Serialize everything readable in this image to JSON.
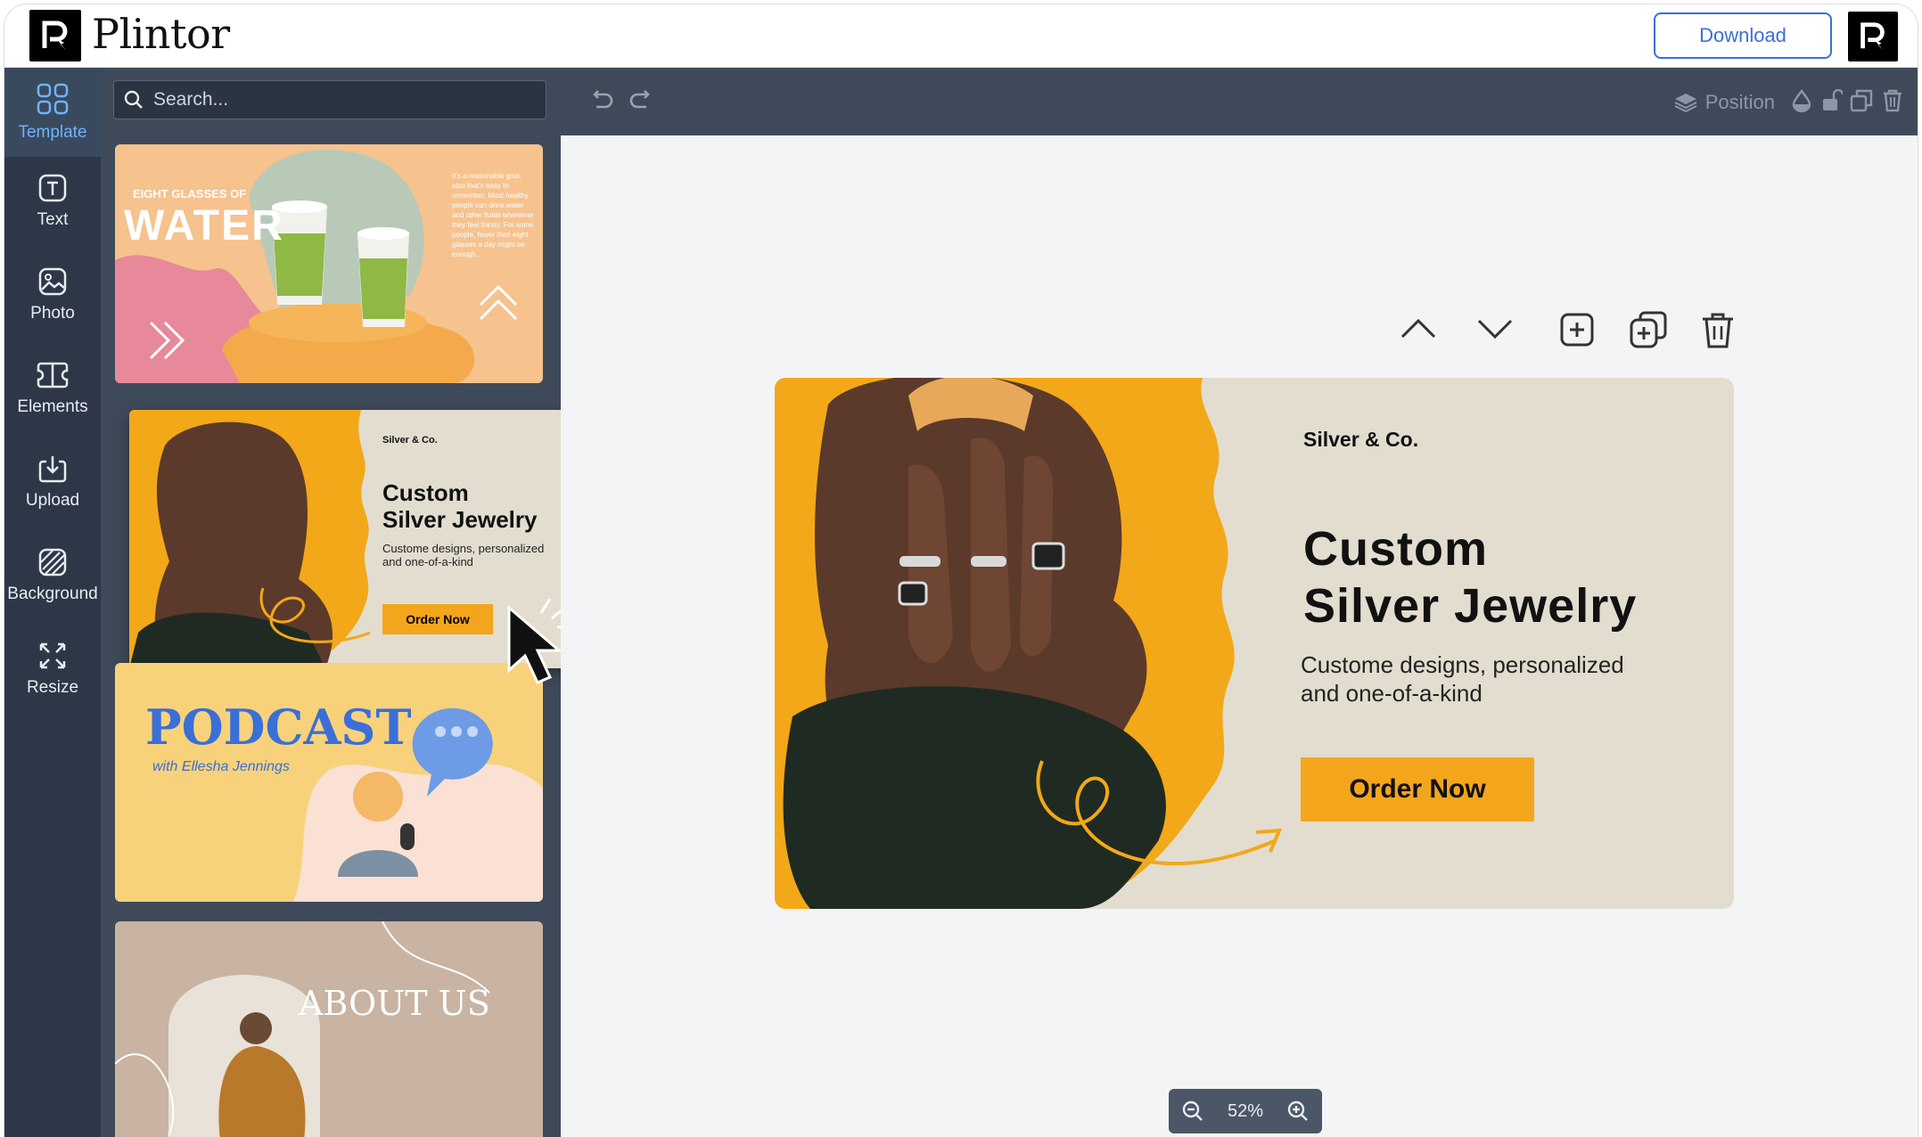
{
  "app": {
    "name": "Plintor"
  },
  "header": {
    "download_label": "Download"
  },
  "sidebar": {
    "items": [
      {
        "label": "Template",
        "icon": "template-icon"
      },
      {
        "label": "Text",
        "icon": "text-icon"
      },
      {
        "label": "Photo",
        "icon": "photo-icon"
      },
      {
        "label": "Elements",
        "icon": "elements-icon"
      },
      {
        "label": "Upload",
        "icon": "upload-icon"
      },
      {
        "label": "Background",
        "icon": "background-icon"
      },
      {
        "label": "Resize",
        "icon": "resize-icon"
      }
    ],
    "active": "Template"
  },
  "panel": {
    "search_placeholder": "Search...",
    "templates": [
      {
        "kicker": "EIGHT GLASSES OF",
        "title": "WATER",
        "body": "It's a reasonable goal, also that's easy to remember. Most healthy people can drink water and other fluids whenever they feel thirsty. For some people, fewer than eight glasses a day might be enough."
      },
      {
        "brand": "Silver & Co.",
        "title_line1": "Custom",
        "title_line2": "Silver Jewelry",
        "subtitle_line1": "Custome designs, personalized",
        "subtitle_line2": "and one-of-a-kind",
        "button": "Order Now"
      },
      {
        "title": "PODCAST",
        "subtitle": "with Ellesha Jennings"
      },
      {
        "title": "ABOUT US"
      }
    ]
  },
  "toolbar": {
    "position_label": "Position"
  },
  "design": {
    "brand": "Silver & Co.",
    "title_line1": "Custom",
    "title_line2": "Silver Jewelry",
    "subtitle_line1": "Custome designs, personalized",
    "subtitle_line2": "and one-of-a-kind",
    "button": "Order Now"
  },
  "zoom": {
    "level": "52%"
  },
  "colors": {
    "accent": "#3a6fd8",
    "sidebar": "#2d3748",
    "panel": "#3e4a5a",
    "orange": "#f3a61c"
  }
}
